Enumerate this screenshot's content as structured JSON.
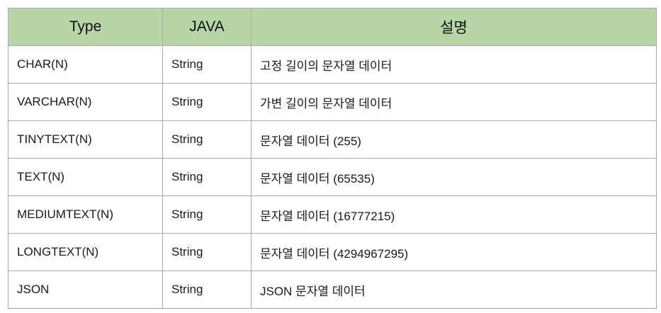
{
  "table": {
    "headers": [
      "Type",
      "JAVA",
      "설명"
    ],
    "rows": [
      {
        "type": "CHAR(N)",
        "java": "String",
        "desc": "고정 길이의 문자열 데이터"
      },
      {
        "type": "VARCHAR(N)",
        "java": "String",
        "desc": "가변 길이의 문자열 데이터"
      },
      {
        "type": "TINYTEXT(N)",
        "java": "String",
        "desc": "문자열 데이터 (255)"
      },
      {
        "type": "TEXT(N)",
        "java": "String",
        "desc": "문자열 데이터 (65535)"
      },
      {
        "type": "MEDIUMTEXT(N)",
        "java": "String",
        "desc": "문자열 데이터 (16777215)"
      },
      {
        "type": "LONGTEXT(N)",
        "java": "String",
        "desc": "문자열 데이터 (4294967295)"
      },
      {
        "type": "JSON",
        "java": "String",
        "desc": "JSON 문자열 데이터"
      }
    ]
  },
  "colors": {
    "header_background": "#b7d6a8",
    "border": "#a9a9a9",
    "text": "#1a1a1a"
  }
}
